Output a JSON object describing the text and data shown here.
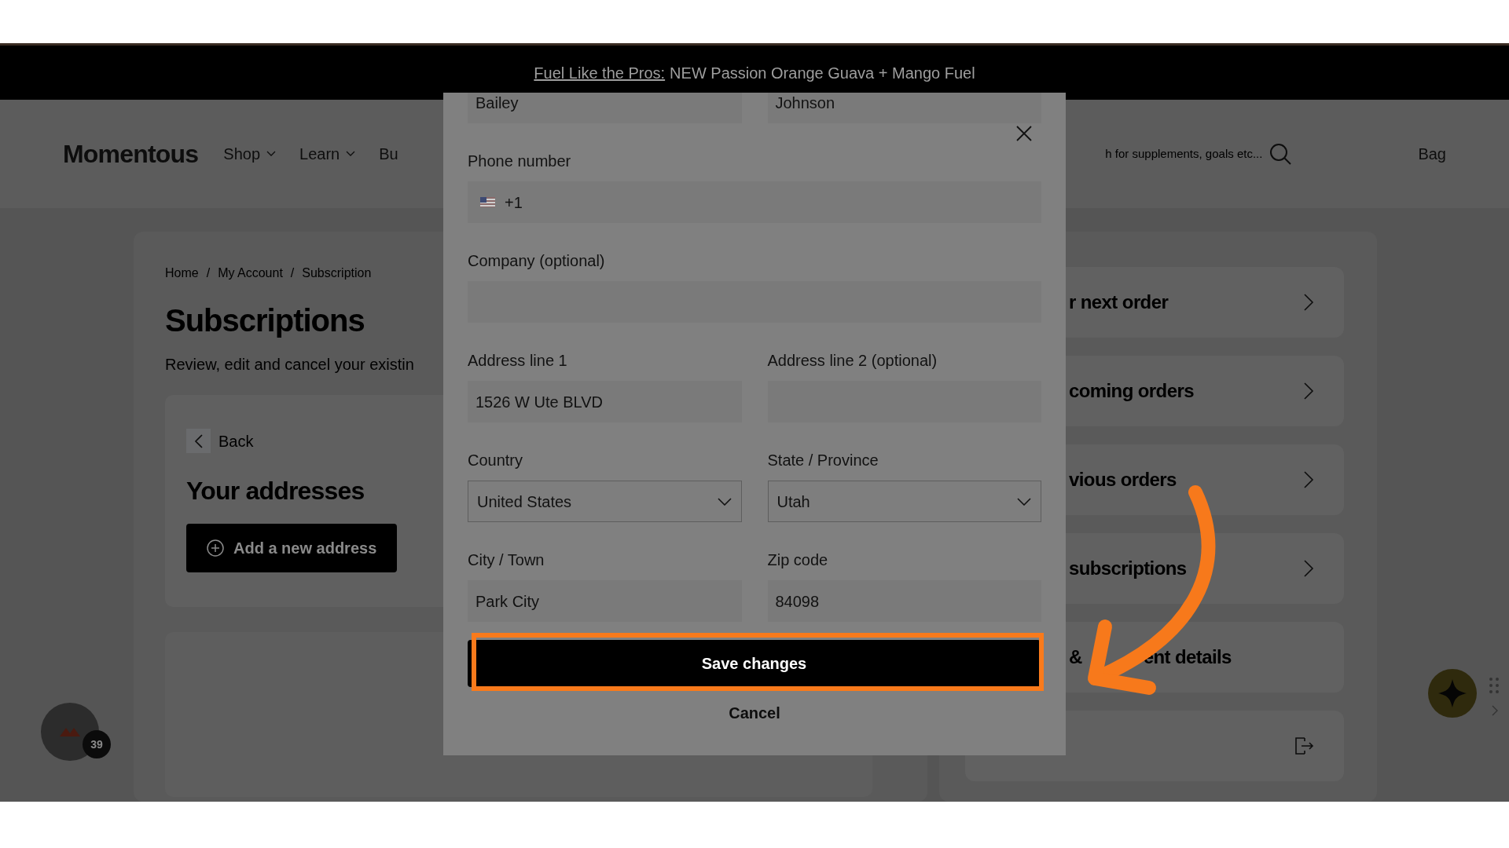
{
  "promo": {
    "link": "Fuel Like the Pros:",
    "text": "NEW Passion Orange Guava + Mango Fuel"
  },
  "header": {
    "logo": "Momentous",
    "nav": [
      {
        "label": "Shop",
        "dropdown": true
      },
      {
        "label": "Learn",
        "dropdown": true
      },
      {
        "label": "Bu",
        "dropdown": false
      }
    ],
    "search": {
      "placeholder": "h for supplements, goals etc..."
    },
    "bag": "Bag"
  },
  "breadcrumb": {
    "items": [
      "Home",
      "My Account",
      "Subscription"
    ],
    "separator": "/"
  },
  "title": "Subscriptions",
  "intro": "Review, edit and cancel your existin",
  "addresses": {
    "back": "Back",
    "heading": "Your addresses",
    "add_button": "Add a new address"
  },
  "account_menu": [
    {
      "kind": "chevron",
      "parts": [
        "r next order"
      ]
    },
    {
      "kind": "chevron",
      "parts": [
        "coming orders"
      ]
    },
    {
      "kind": "chevron",
      "parts": [
        "vious orders"
      ]
    },
    {
      "kind": "chevron",
      "parts": [
        "subscriptions"
      ]
    },
    {
      "kind": "plain",
      "parts": [
        "&",
        "ent details"
      ]
    },
    {
      "kind": "logout"
    }
  ],
  "chat": {
    "badge": "39"
  },
  "modal": {
    "rows": [
      [
        {
          "kind": "text",
          "value": "Bailey"
        },
        {
          "kind": "text",
          "value": "Johnson"
        }
      ],
      [
        {
          "kind": "phone",
          "label": "Phone number",
          "value": "+1"
        }
      ],
      [
        {
          "kind": "text",
          "label": "Company (optional)"
        }
      ],
      [
        {
          "kind": "text",
          "label": "Address line 1",
          "value": "1526 W Ute BLVD"
        },
        {
          "kind": "text",
          "label": "Address line 2 (optional)"
        }
      ],
      [
        {
          "kind": "select",
          "label": "Country",
          "value": "United States"
        },
        {
          "kind": "select",
          "label": "State / Province",
          "value": "Utah"
        }
      ],
      [
        {
          "kind": "text",
          "label": "City / Town",
          "value": "Park City"
        },
        {
          "kind": "text",
          "label": "Zip code",
          "value": "84098"
        }
      ]
    ],
    "save": "Save changes",
    "cancel": "Cancel"
  }
}
